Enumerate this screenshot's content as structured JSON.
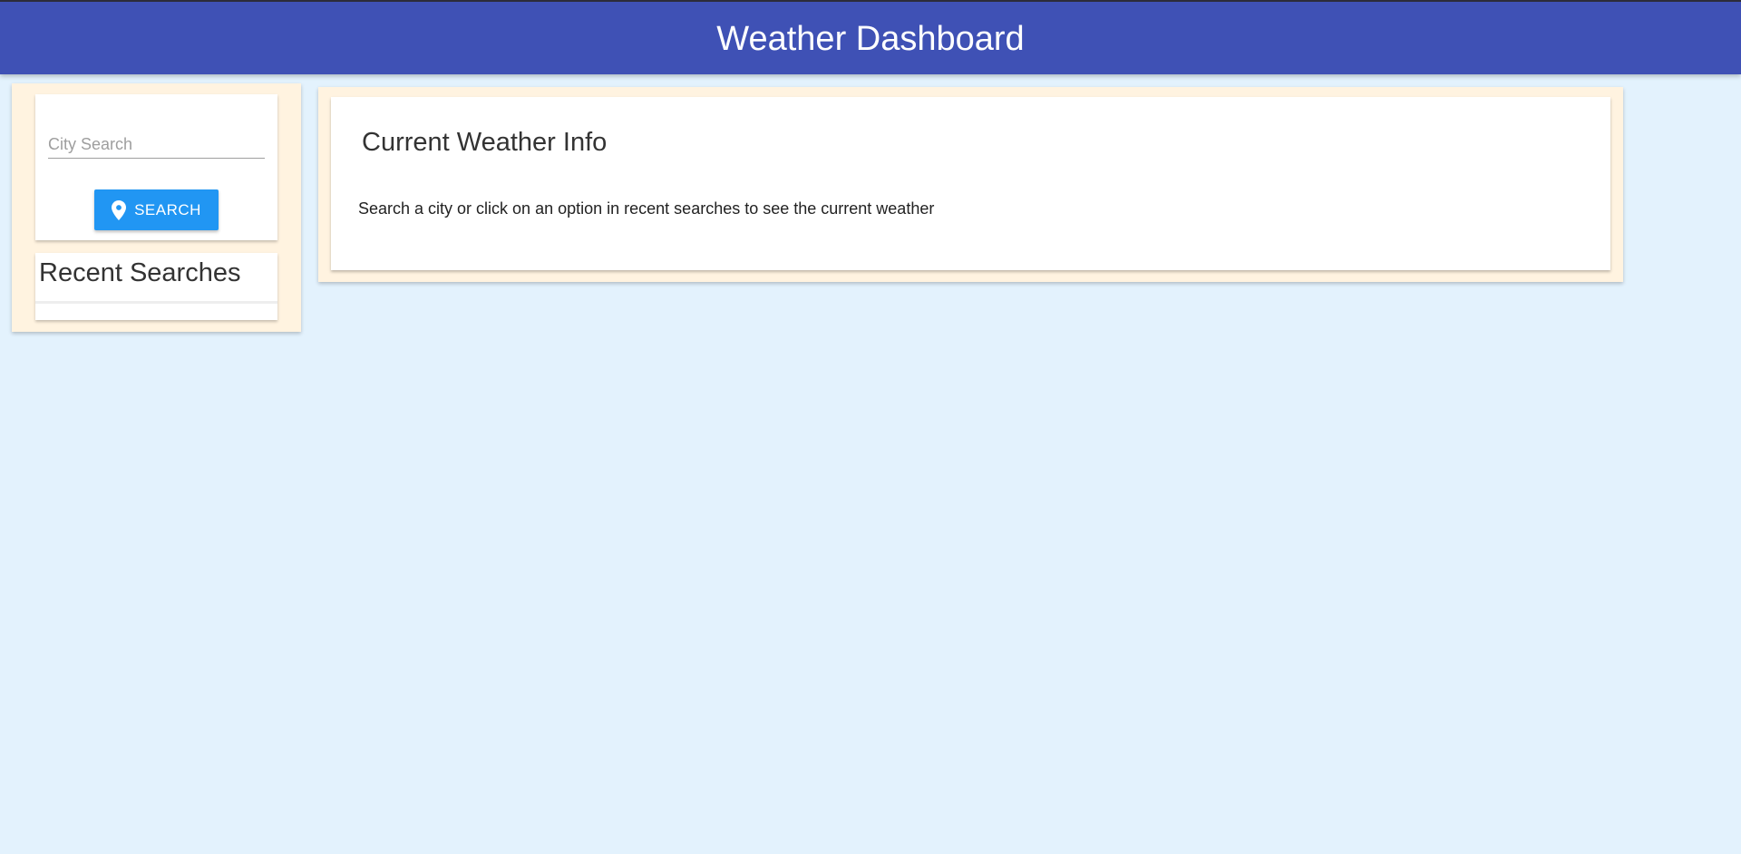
{
  "header": {
    "title": "Weather Dashboard",
    "background": "#3f51b5"
  },
  "sidebar": {
    "search": {
      "placeholder": "City Search",
      "value": "",
      "button_label": "SEARCH",
      "button_icon": "location-pin-icon",
      "button_color": "#2196f3"
    },
    "recent": {
      "title": "Recent Searches",
      "items": []
    }
  },
  "main": {
    "title": "Current Weather Info",
    "message": "Search a city or click on an option in recent searches to see the current weather"
  },
  "colors": {
    "page_background": "#e3f2fd",
    "panel_background": "#fff3e0",
    "card_background": "#ffffff"
  }
}
